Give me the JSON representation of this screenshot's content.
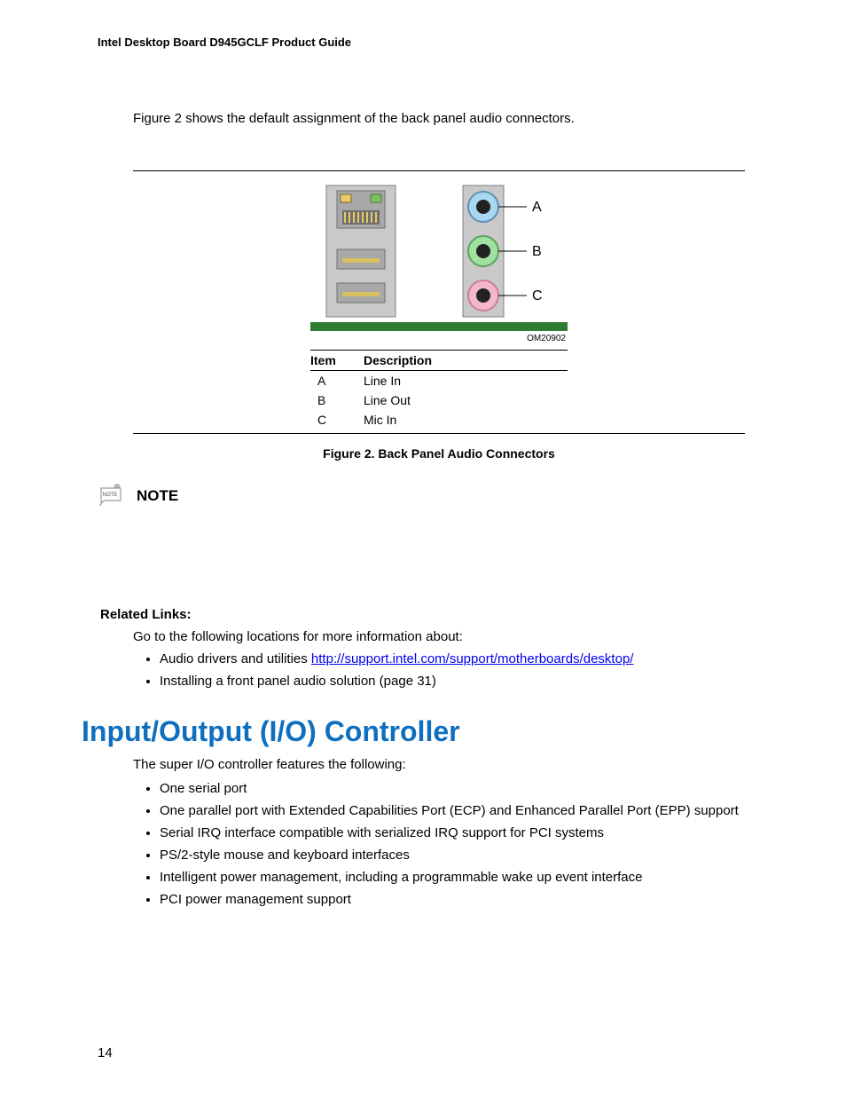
{
  "header": {
    "title": "Intel Desktop Board D945GCLF Product Guide"
  },
  "intro": "Figure 2 shows the default assignment of the back panel audio connectors.",
  "figure": {
    "diagram_id": "OM20902",
    "labels": {
      "a": "A",
      "b": "B",
      "c": "C"
    },
    "table": {
      "headers": {
        "item": "Item",
        "description": "Description"
      },
      "rows": [
        {
          "item": "A",
          "desc": "Line In"
        },
        {
          "item": "B",
          "desc": "Line Out"
        },
        {
          "item": "C",
          "desc": "Mic In"
        }
      ]
    },
    "caption": "Figure 2.  Back Panel Audio Connectors"
  },
  "note": {
    "label": "NOTE",
    "icon_text": "NOTE"
  },
  "related": {
    "heading": "Related Links:",
    "intro": "Go to the following locations for more information about:",
    "items": [
      {
        "prefix": "Audio drivers and utilities ",
        "link": "http://support.intel.com/support/motherboards/desktop/"
      },
      {
        "text": "Installing a front panel audio solution (page 31)"
      }
    ]
  },
  "io": {
    "heading": "Input/Output (I/O) Controller",
    "intro": "The super I/O controller features the following:",
    "bullets": [
      "One serial port",
      "One parallel port with Extended Capabilities Port (ECP) and Enhanced Parallel Port (EPP) support",
      "Serial IRQ interface compatible with serialized IRQ support for PCI systems",
      "PS/2-style mouse and keyboard interfaces",
      "Intelligent power management, including a programmable wake up event interface",
      "PCI power management support"
    ]
  },
  "page_number": "14"
}
